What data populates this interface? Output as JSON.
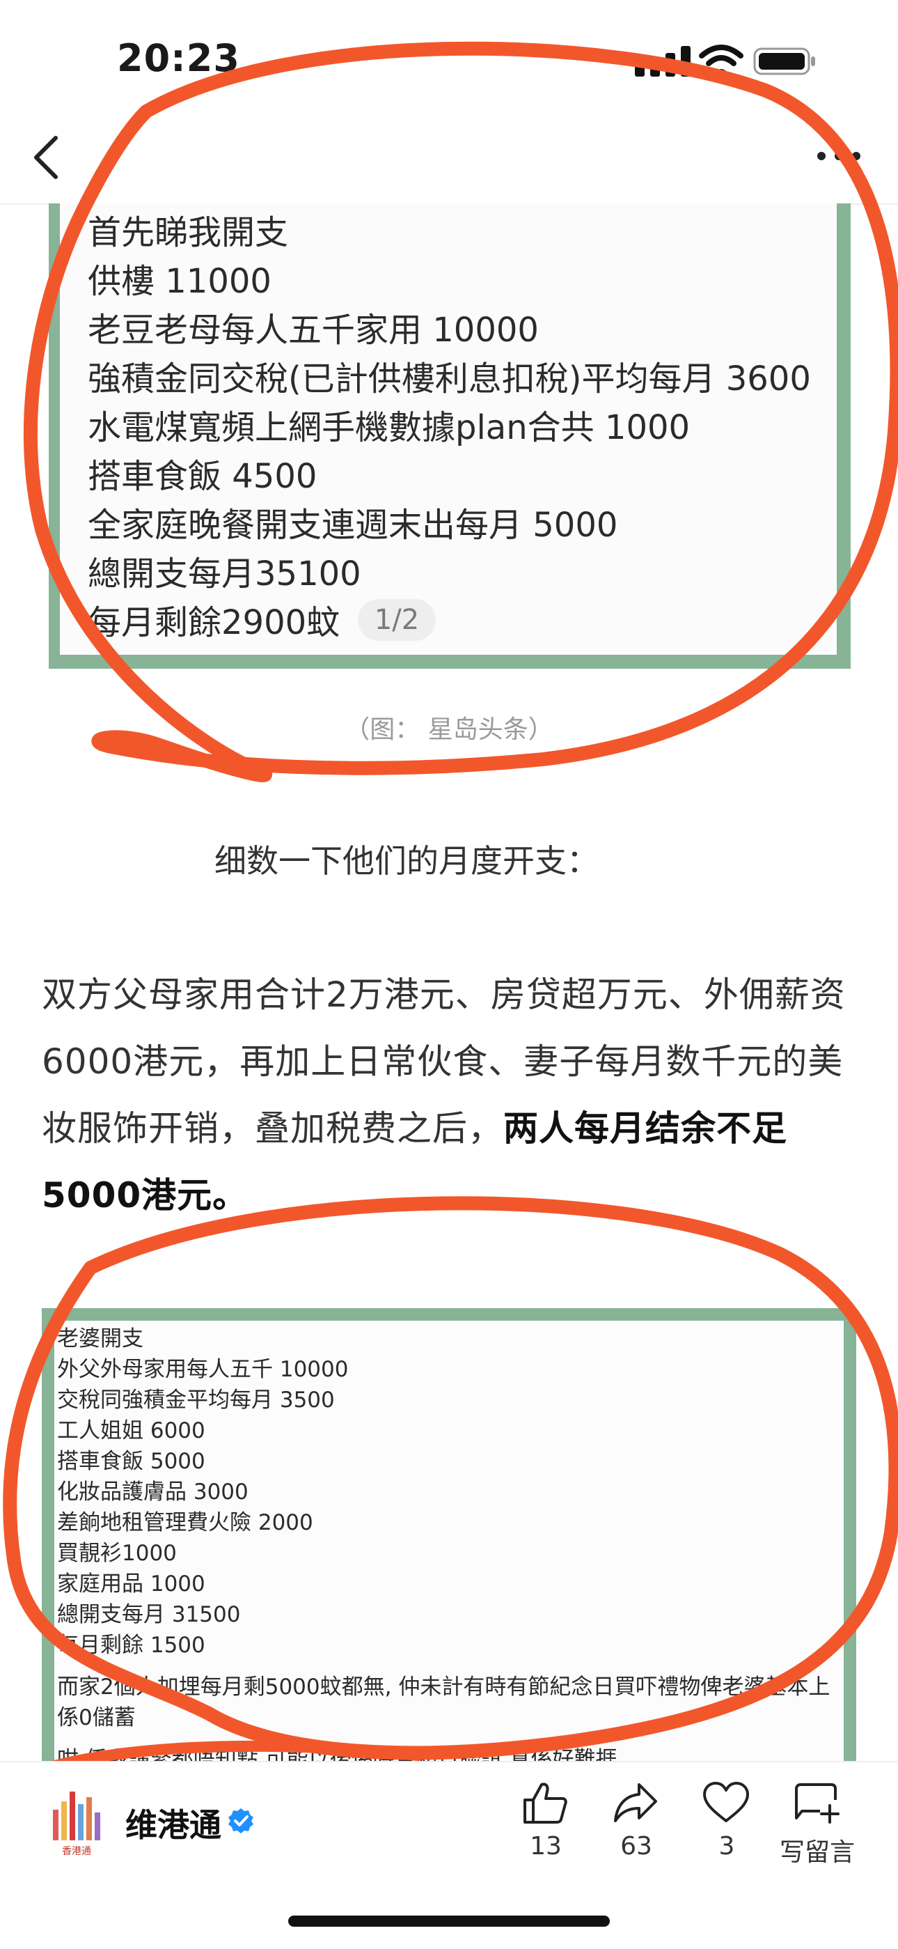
{
  "status_bar": {
    "time": "20:23"
  },
  "image1": {
    "lines": [
      "首先睇我開支",
      "供樓 11000",
      "老豆老母每人五千家用 10000",
      "強積金同交稅(已計供樓利息扣稅)平均每月 3600",
      "水電煤寬頻上網手機數據plan合共 1000",
      "搭車食飯 4500",
      "全家庭晚餐開支連週末出每月 5000",
      "總開支每月35100",
      "每月剩餘2900蚊"
    ],
    "page_indicator": "1/2",
    "caption": "（图：  星岛头条）"
  },
  "article": {
    "subheading": "细数一下他们的月度开支：",
    "paragraph_normal": "双方父母家用合计2万港元、房贷超万元、外佣薪资6000港元，再加上日常伙食、妻子每月数千元的美妆服饰开销，叠加税费之后，",
    "paragraph_bold": "两人每月结余不足5000港元。"
  },
  "image2": {
    "lines": [
      "老婆開支",
      "外父外母家用每人五千 10000",
      "交稅同強積金平均每月 3500",
      "工人姐姐 6000",
      "搭車食飯 5000",
      "化妝品護膚品 3000",
      "差餉地租管理費火險 2000",
      "買靚衫1000",
      "家庭用品 1000",
      "總開支每月 31500",
      "每月剩餘 1500",
      "而家2個人加埋每月剩5000蚊都無, 仲未計有時有節紀念日買吓禮物俾老婆基本上",
      "係0儲蓄",
      "咁 係我講緊都唔知點 可能以後係時月初日聯誼 真係好難捱"
    ]
  },
  "bottom_bar": {
    "author": "维港通",
    "logo_text": "香港通",
    "likes": "13",
    "shares": "63",
    "favorites": "3",
    "comment_label": "写留言"
  },
  "colors": {
    "frame_green": "#87b397",
    "annotation_red": "#f2572b",
    "verified_blue": "#1e90ff"
  }
}
